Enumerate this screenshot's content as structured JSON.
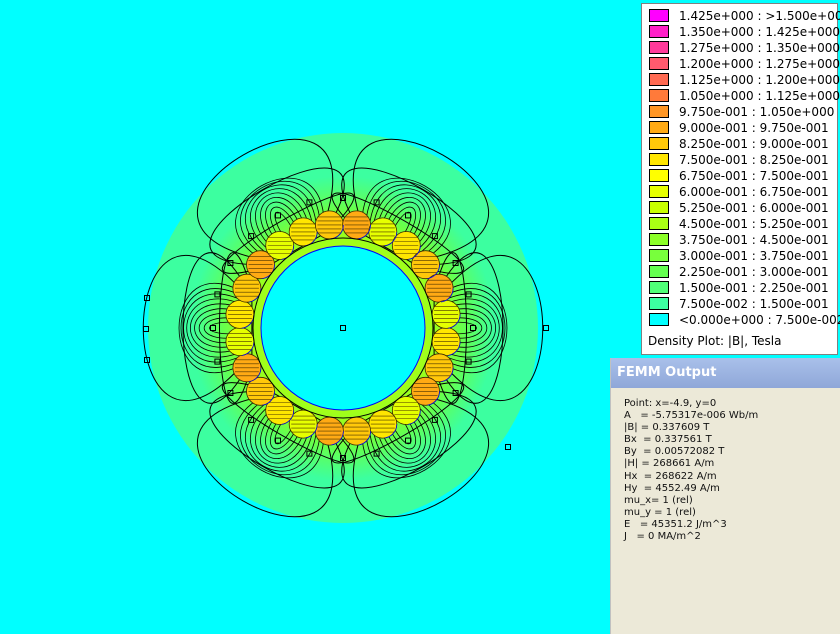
{
  "legend": {
    "rows": [
      {
        "color": "#ff00ff",
        "label": "1.425e+000 : >1.500e+000"
      },
      {
        "color": "#ff1fc8",
        "label": "1.350e+000 : 1.425e+000"
      },
      {
        "color": "#ff3a9a",
        "label": "1.275e+000 : 1.350e+000"
      },
      {
        "color": "#ff5a6e",
        "label": "1.200e+000 : 1.275e+000"
      },
      {
        "color": "#ff6a52",
        "label": "1.125e+000 : 1.200e+000"
      },
      {
        "color": "#ff7a3a",
        "label": "1.050e+000 : 1.125e+000"
      },
      {
        "color": "#ff9624",
        "label": "9.750e-001 : 1.050e+000"
      },
      {
        "color": "#ffaa14",
        "label": "9.000e-001 : 9.750e-001"
      },
      {
        "color": "#ffc80a",
        "label": "8.250e-001 : 9.000e-001"
      },
      {
        "color": "#ffe600",
        "label": "7.500e-001 : 8.250e-001"
      },
      {
        "color": "#ffff00",
        "label": "6.750e-001 : 7.500e-001"
      },
      {
        "color": "#e6ff00",
        "label": "6.000e-001 : 6.750e-001"
      },
      {
        "color": "#c8ff00",
        "label": "5.250e-001 : 6.000e-001"
      },
      {
        "color": "#aaff14",
        "label": "4.500e-001 : 5.250e-001"
      },
      {
        "color": "#8cff28",
        "label": "3.750e-001 : 4.500e-001"
      },
      {
        "color": "#78ff3c",
        "label": "3.000e-001 : 3.750e-001"
      },
      {
        "color": "#64ff50",
        "label": "2.250e-001 : 3.000e-001"
      },
      {
        "color": "#50ff78",
        "label": "1.500e-001 : 2.250e-001"
      },
      {
        "color": "#3cffa0",
        "label": "7.500e-002 : 1.500e-001"
      },
      {
        "color": "#00ffff",
        "label": "<0.000e+000 : 7.500e-002"
      }
    ],
    "title": "Density Plot: |B|, Tesla"
  },
  "output": {
    "title": "FEMM Output",
    "lines": [
      "Point: x=-4.9, y=0",
      "A   = -5.75317e-006 Wb/m",
      "|B| = 0.337609 T",
      "Bx  = 0.337561 T",
      "By  = 0.00572082 T",
      "|H| = 268661 A/m",
      "Hx  = 268622 A/m",
      "Hy  = 4552.49 A/m",
      "mu_x= 1 (rel)",
      "mu_y = 1 (rel)",
      "E   = 45351.2 J/m^3",
      "J   = 0 MA/m^2"
    ]
  },
  "colors": {
    "background": "#00ffff",
    "outer_zone": "#3cffa0",
    "coil": "#ffe600",
    "field_line": "#000000",
    "boundary": "#0000ff"
  }
}
